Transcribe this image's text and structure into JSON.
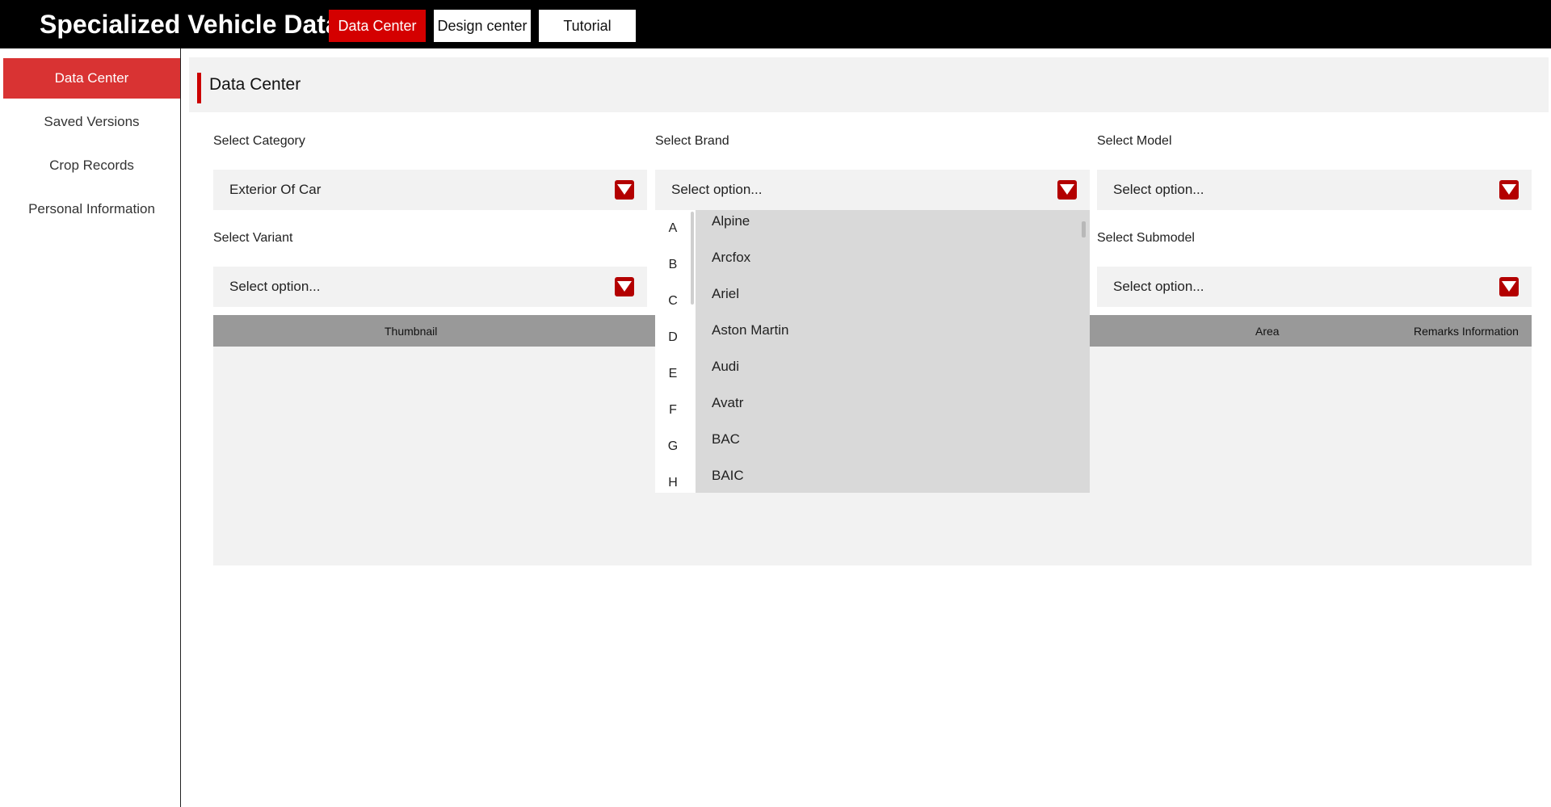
{
  "app": {
    "title": "Specialized Vehicle Data"
  },
  "topnav": {
    "data_center": "Data Center",
    "design_center": "Design center",
    "tutorial": "Tutorial"
  },
  "sidebar": {
    "items": [
      {
        "label": "Data Center",
        "active": true
      },
      {
        "label": "Saved Versions",
        "active": false
      },
      {
        "label": "Crop Records",
        "active": false
      },
      {
        "label": "Personal Information",
        "active": false
      }
    ]
  },
  "section": {
    "title": "Data Center"
  },
  "filters": {
    "category": {
      "label": "Select Category",
      "value": "Exterior Of Car"
    },
    "brand": {
      "label": "Select Brand",
      "value": "Select option..."
    },
    "model": {
      "label": "Select Model",
      "value": "Select option..."
    },
    "variant": {
      "label": "Select Variant",
      "value": "Select option..."
    },
    "submodel": {
      "label": "Select Submodel",
      "value": "Select option..."
    }
  },
  "table": {
    "columns": [
      "Thumbnail",
      "Area",
      "Remarks Information"
    ]
  },
  "brand_dropdown": {
    "letters": [
      "A",
      "B",
      "C",
      "D",
      "E",
      "F",
      "G",
      "H"
    ],
    "options": [
      "Alpine",
      "Arcfox",
      "Ariel",
      "Aston Martin",
      "Audi",
      "Avatr",
      "BAC",
      "BAIC"
    ]
  },
  "colors": {
    "accent": "#d40000",
    "sidebar_active": "#d93333",
    "caret": "#b30000",
    "panel": "#f2f2f2",
    "table_head": "#999999",
    "dropdown": "#d9d9d9"
  },
  "icons": {
    "select_caret": "caret-down-icon"
  }
}
